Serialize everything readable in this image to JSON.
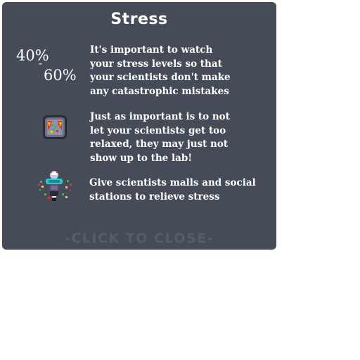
{
  "dialog": {
    "title": "Stress",
    "stress_range": {
      "low": "40%",
      "separator": "-",
      "high": "60%"
    },
    "sections": [
      {
        "icon": "stress-meter-icon",
        "text": "It's important to watch\nyour stress levels so that\nyour scientists don't make\nany catastrophic mistakes"
      },
      {
        "icon": "relaxed-scientist-pod-icon",
        "text": "Just as important is to not\nlet your scientists get too\nrelaxed, they may just not\nshow up to the lab!"
      },
      {
        "icon": "social-station-icon",
        "text": "Give scientists malls and social\nstations to relieve stress"
      }
    ],
    "close_label": "-CLICK TO CLOSE-"
  }
}
